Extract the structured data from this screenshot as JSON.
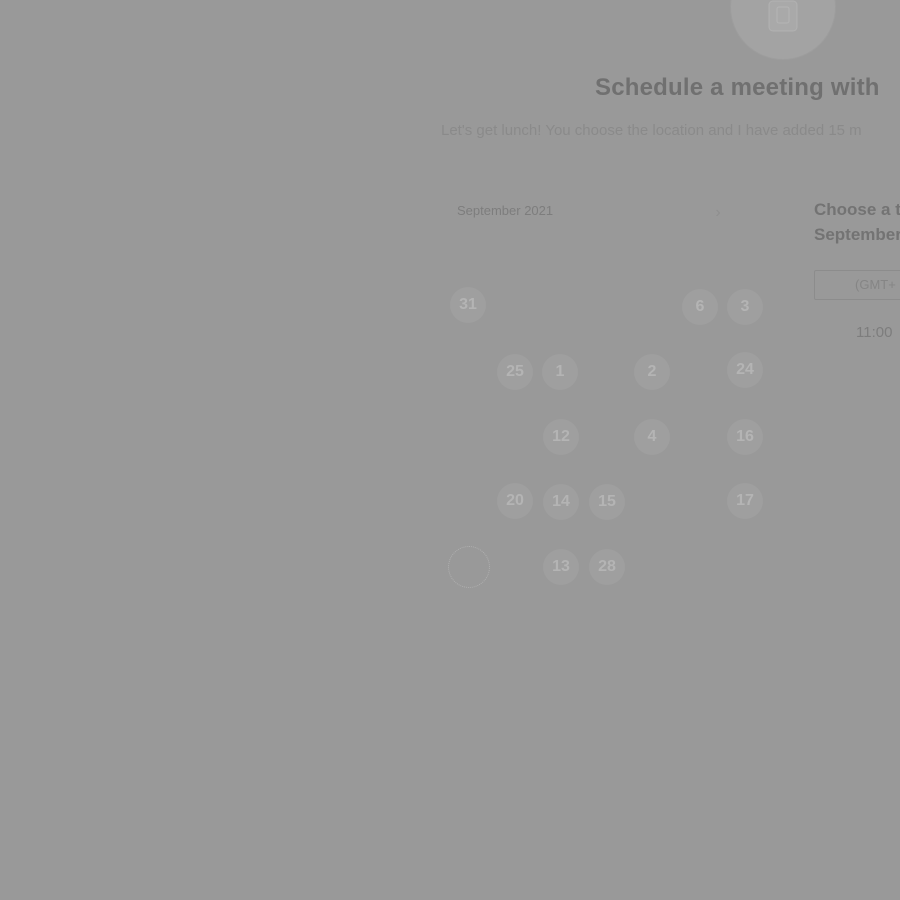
{
  "header": {
    "title": "Schedule a meeting with",
    "subtitle": "Let's get lunch! You choose the location and I have added 15 m"
  },
  "calendar": {
    "month_label": "September 2021",
    "next_icon": "chevron-right-icon",
    "days": [
      {
        "label": "31",
        "available": true
      },
      {
        "label": "6",
        "available": true
      },
      {
        "label": "3",
        "available": true
      },
      {
        "label": "25",
        "available": true
      },
      {
        "label": "1",
        "available": true
      },
      {
        "label": "2",
        "available": true
      },
      {
        "label": "24",
        "available": true
      },
      {
        "label": "12",
        "available": true
      },
      {
        "label": "4",
        "available": true
      },
      {
        "label": "16",
        "available": true
      },
      {
        "label": "20",
        "available": true
      },
      {
        "label": "14",
        "available": true
      },
      {
        "label": "15",
        "available": true
      },
      {
        "label": "17",
        "available": true
      },
      {
        "label": "13",
        "available": true
      },
      {
        "label": "28",
        "available": true
      }
    ]
  },
  "times": {
    "heading_line1": "Choose a t",
    "heading_line2": "September",
    "timezone": "(GMT+",
    "slot": "11:00"
  }
}
